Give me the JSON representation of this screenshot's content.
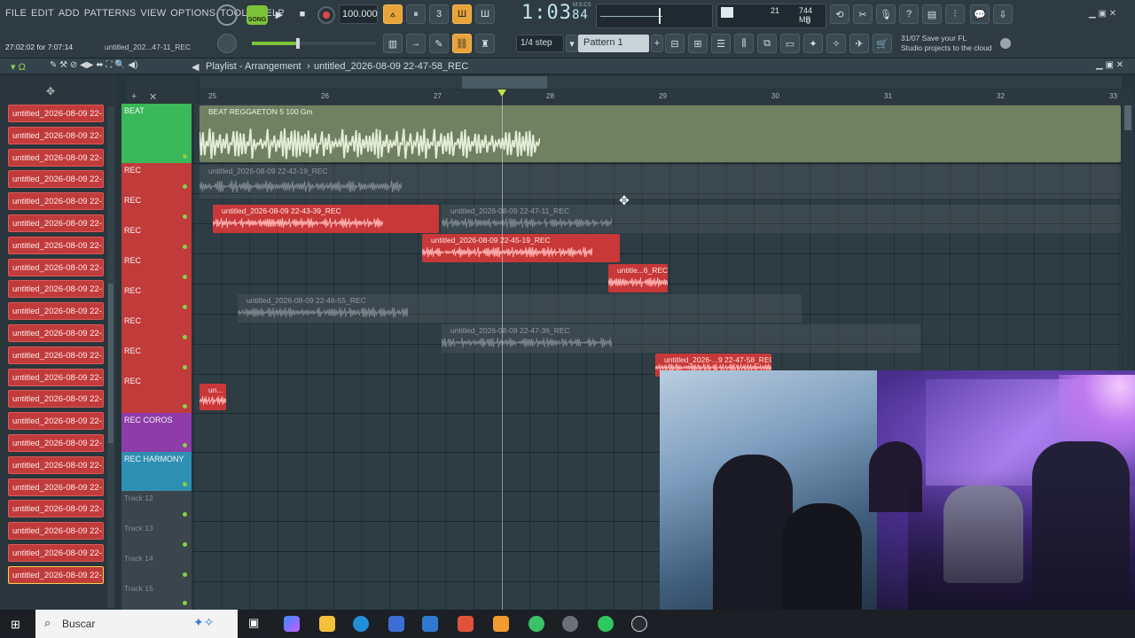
{
  "menu": [
    "FILE",
    "EDIT",
    "ADD",
    "PATTERNS",
    "VIEW",
    "OPTIONS",
    "TOOLS",
    "HELP"
  ],
  "transport": {
    "song_label": "SONG",
    "tempo": "100.000",
    "time": "1:03",
    "time_frac": "84",
    "time_unit": "M:S:CS",
    "cpu_value": "21",
    "ram_value": "744 MB",
    "ram_sub": "0"
  },
  "hint": {
    "line1": "27:02:02 for 7:07:14",
    "line2": "untitled_202...47-11_REC"
  },
  "snap": "1/4 step",
  "pattern": "Pattern 1",
  "cloud": {
    "date": "31/07",
    "title": "Save your FL",
    "subtitle": "Studio projects to the cloud"
  },
  "playlist": {
    "title": "Playlist - Arrangement",
    "file": "untitled_2026-08-09 22-47-58_REC"
  },
  "ruler": [
    "25",
    "26",
    "27",
    "28",
    "29",
    "30",
    "31",
    "32",
    "33"
  ],
  "picker_items": [
    "untitled_2026-08-09 22-...",
    "untitled_2026-08-09 22-...",
    "untitled_2026-08-09 22-...",
    "untitled_2026-08-09 22-...",
    "untitled_2026-08-09 22-...",
    "untitled_2026-08-09 22-...",
    "untitled_2026-08-09 22-...",
    "untitled_2026-08-09 22-...",
    "untitled_2026-08-09 22-...",
    "untitled_2026-08-09 22-...",
    "untitled_2026-08-09 22-...",
    "untitled_2026-08-09 22-...",
    "untitled_2026-08-09 22-...",
    "untitled_2026-08-09 22-...",
    "untitled_2026-08-09 22-...",
    "untitled_2026-08-09 22-...",
    "untitled_2026-08-09 22-...",
    "untitled_2026-08-09 22-...",
    "untitled_2026-08-09 22-...",
    "untitled_2026-08-09 22-...",
    "untitled_2026-08-09 22-...",
    "untitled_2026-08-09 22-..."
  ],
  "tracks": [
    {
      "name": "BEAT",
      "color": "#3bb85a"
    },
    {
      "name": "REC",
      "color": "#c23b3b"
    },
    {
      "name": "REC",
      "color": "#c23b3b"
    },
    {
      "name": "REC",
      "color": "#c23b3b"
    },
    {
      "name": "REC",
      "color": "#c23b3b"
    },
    {
      "name": "REC",
      "color": "#c23b3b"
    },
    {
      "name": "REC",
      "color": "#c23b3b"
    },
    {
      "name": "REC",
      "color": "#c23b3b"
    },
    {
      "name": "REC",
      "color": "#c23b3b"
    },
    {
      "name": "REC COROS",
      "color": "#8e3ca8"
    },
    {
      "name": "REC HARMONY",
      "color": "#2f8fb3"
    },
    {
      "name": "Track 12",
      "color": "#3a464c"
    },
    {
      "name": "Track 13",
      "color": "#3a464c"
    },
    {
      "name": "Track 14",
      "color": "#3a464c"
    },
    {
      "name": "Track 15",
      "color": "#3a464c"
    }
  ],
  "clips": {
    "beat": "BEAT REGGAETON 5 100 Gm",
    "rec1": "untitled_2026-08-09 22-42-19_REC",
    "rec2": "untitled_2026-08-09 22-43-39_REC",
    "rec2b": "untitled_2026-08-09 22-47-11_REC",
    "rec3": "untitled_2026-08-09 22-45-19_REC",
    "rec4": "untitle...6_REC",
    "rec5": "untitled_2026-08-09 22-46-55_REC",
    "rec6": "untitled_2026-08-09 22-47-36_REC",
    "rec7": "untitled_2026-...9 22-47-58_REC",
    "rec8": "un..."
  },
  "taskbar": {
    "search_placeholder": "Buscar"
  }
}
